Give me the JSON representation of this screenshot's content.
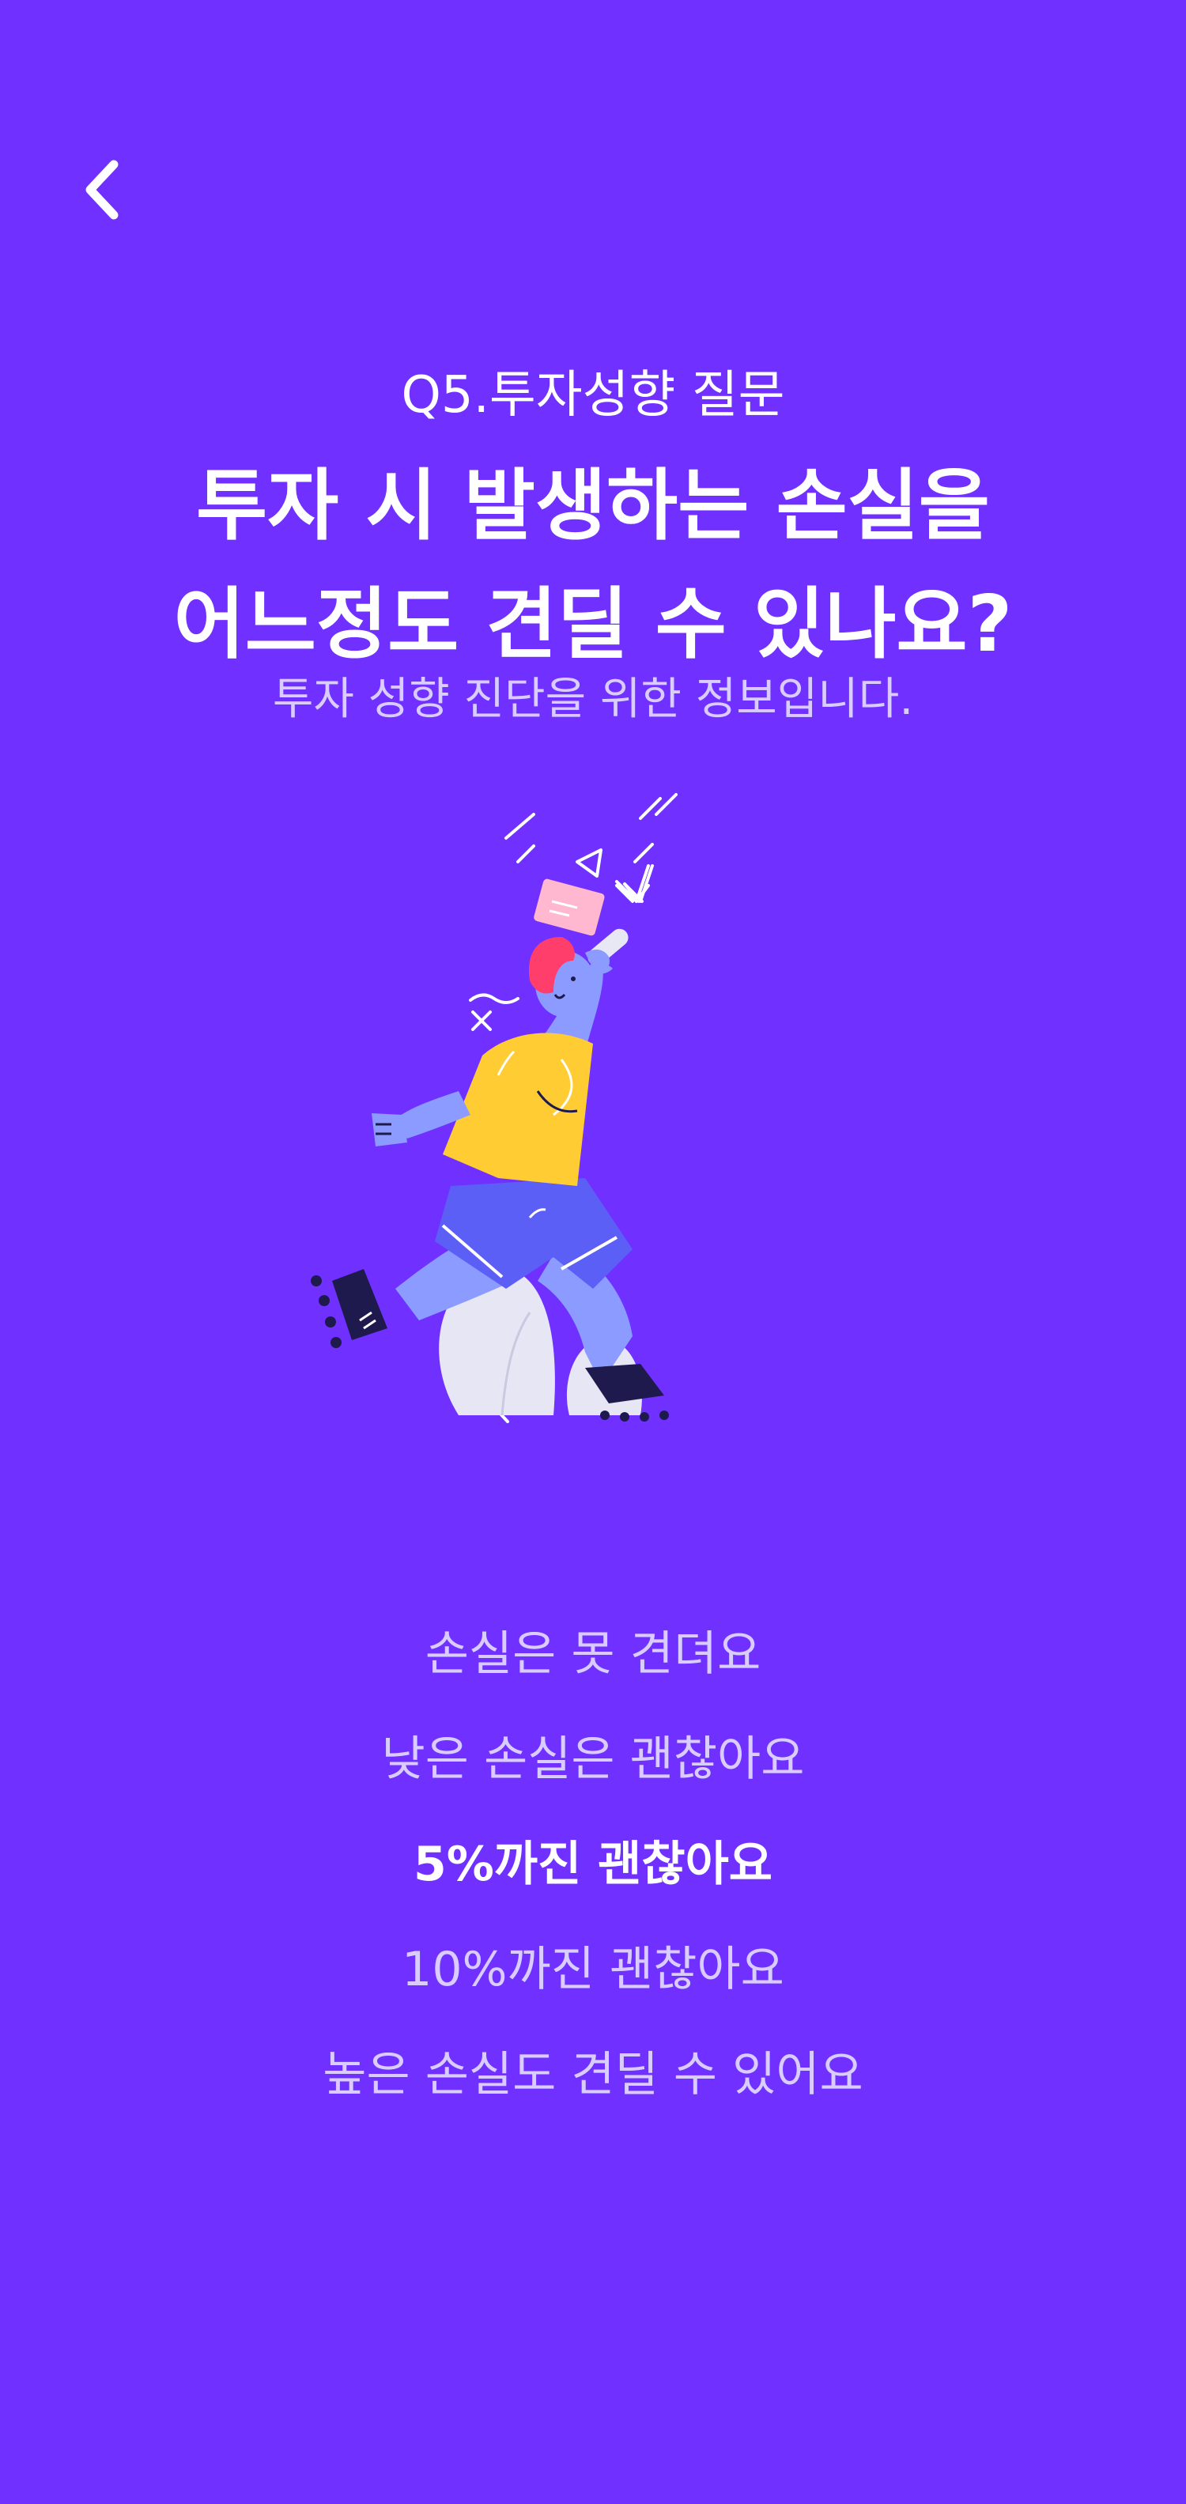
{
  "header": {
    "back_icon": "chevron-left-icon"
  },
  "question": {
    "label": "Q5.투자성향 질문",
    "title_line1": "투자 시 발생하는 손실을",
    "title_line2": "어느정도 견딜 수 있나요?",
    "subtitle": "투자 성향 진단을 위한 정보입니다."
  },
  "illustration": {
    "icon": "person-on-rollerskates-illustration"
  },
  "options": [
    {
      "label": "손실은 못 견뎌요",
      "selected": false
    },
    {
      "label": "낮은 손실은 괜찮아요",
      "selected": false
    },
    {
      "label": "5%까진 괜찮아요",
      "selected": true
    },
    {
      "label": "10%까진 괜찮아요",
      "selected": false
    },
    {
      "label": "높은 손실도 견딜 수 있어요",
      "selected": false
    }
  ],
  "colors": {
    "background": "#7030FF",
    "text_primary": "#FFFFFF",
    "text_secondary": "#D9CCFF",
    "shirt": "#FFCC33",
    "shorts": "#5C5FF5",
    "skin": "#8C9BFF",
    "hair": "#FF3E6C"
  }
}
